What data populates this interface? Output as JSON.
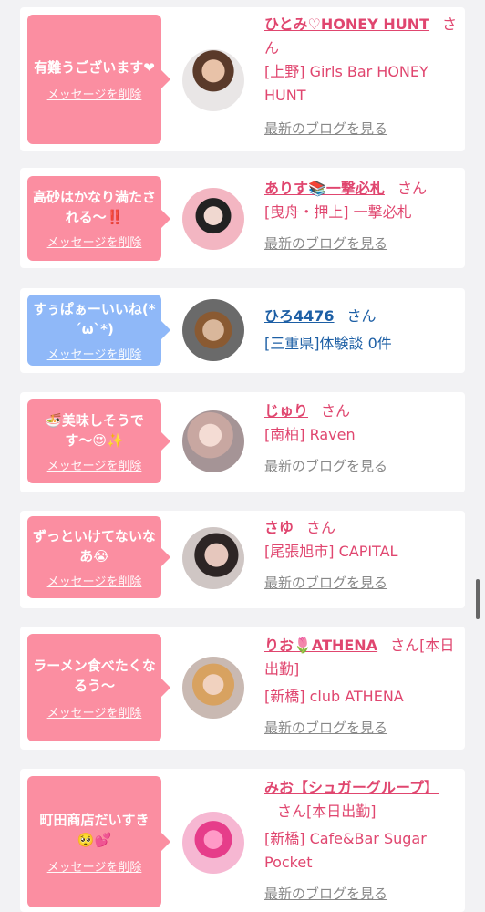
{
  "cards": [
    {
      "message": "有難うございます❤",
      "delete_label": "メッセージを削除",
      "name": "ひとみ♡HONEY HUNT",
      "san": "さん",
      "shop": "[上野] Girls Bar HONEY HUNT",
      "blog": "最新のブログを見る"
    },
    {
      "message": "高砂はかなり満たされる〜‼️",
      "delete_label": "メッセージを削除",
      "name": "ありす📚一撃必札",
      "san": "さん",
      "shop": "[曳舟・押上] 一撃必札",
      "blog": "最新のブログを見る"
    },
    {
      "message": "すぅぱぁーいいね(*´ω`*)",
      "delete_label": "メッセージを削除",
      "name": "ひろ4476",
      "san": "さん",
      "shop": "[三重県]体験談 0件"
    },
    {
      "message": "🍜美味しそうです〜😍✨",
      "delete_label": "メッセージを削除",
      "name": "じゅり",
      "san": "さん",
      "shop": "[南柏] Raven",
      "blog": "最新のブログを見る"
    },
    {
      "message": "ずっといけてないなあ😭",
      "delete_label": "メッセージを削除",
      "name": "さゆ",
      "san": "さん",
      "shop": "[尾張旭市] CAPITAL",
      "blog": "最新のブログを見る"
    },
    {
      "message": "ラーメン食べたくなるう〜",
      "delete_label": "メッセージを削除",
      "name": "りお🌷ATHENA",
      "san": "さん[本日出勤]",
      "shop": "[新橋] club ATHENA",
      "blog": "最新のブログを見る"
    },
    {
      "message": "町田商店だいすき🥺💕",
      "delete_label": "メッセージを削除",
      "name": "みお【シュガーグループ】",
      "san": "さん[本日出勤]",
      "shop": "[新橋] Cafe&Bar Sugar Pocket",
      "blog": "最新のブログを見る"
    }
  ],
  "colors": {
    "accent_pink": "#fb8ea1",
    "accent_blue": "#8fb8f8",
    "name_pink": "#e0466f",
    "name_blue": "#1d5fa5"
  }
}
